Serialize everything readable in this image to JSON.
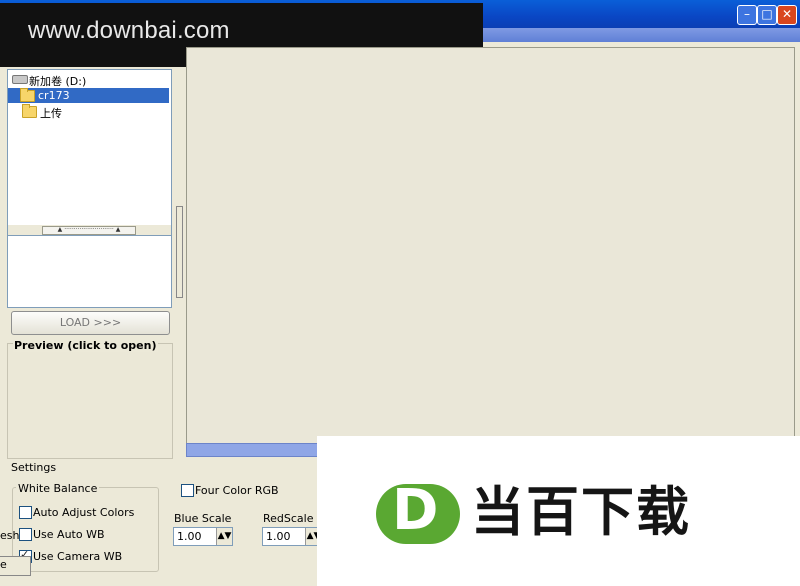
{
  "watermark": {
    "text": "www.downbai.com"
  },
  "window_controls": {
    "minimize": "–",
    "maximize": "□",
    "close": "✕"
  },
  "tree": {
    "items": [
      {
        "label": "新加卷 (D:)",
        "icon": "drive-icon",
        "selected": false
      },
      {
        "label": "cr173",
        "icon": "folder-icon",
        "selected": true
      },
      {
        "label": "上传",
        "icon": "folder-icon",
        "selected": false
      }
    ]
  },
  "splitter": {
    "glyph": "▲ ·························· ▲"
  },
  "load_button": {
    "label": "LOAD >>>"
  },
  "preview": {
    "title": "Preview (click to open)"
  },
  "settings": {
    "label": "Settings",
    "white_balance": {
      "title": "White Balance",
      "options": [
        {
          "label": "Auto Adjust Colors",
          "checked": false
        },
        {
          "label": "Use Auto WB",
          "checked": false
        },
        {
          "label": "Use Camera WB",
          "checked": true
        }
      ]
    },
    "four_color_rgb": {
      "label": "Four Color RGB",
      "checked": false
    },
    "blue_scale": {
      "label": "Blue Scale",
      "value": "1.00"
    },
    "red_scale": {
      "label": "RedScale",
      "value": "1.00"
    },
    "cut_label_1": "esh",
    "cut_label_2": "e"
  },
  "logo": {
    "letter": "D",
    "text": "当百下载",
    "green": "#5aa832"
  },
  "colors": {
    "titlebar": "#0a46c4",
    "selection": "#316ac5",
    "panel": "#ece9d8"
  }
}
